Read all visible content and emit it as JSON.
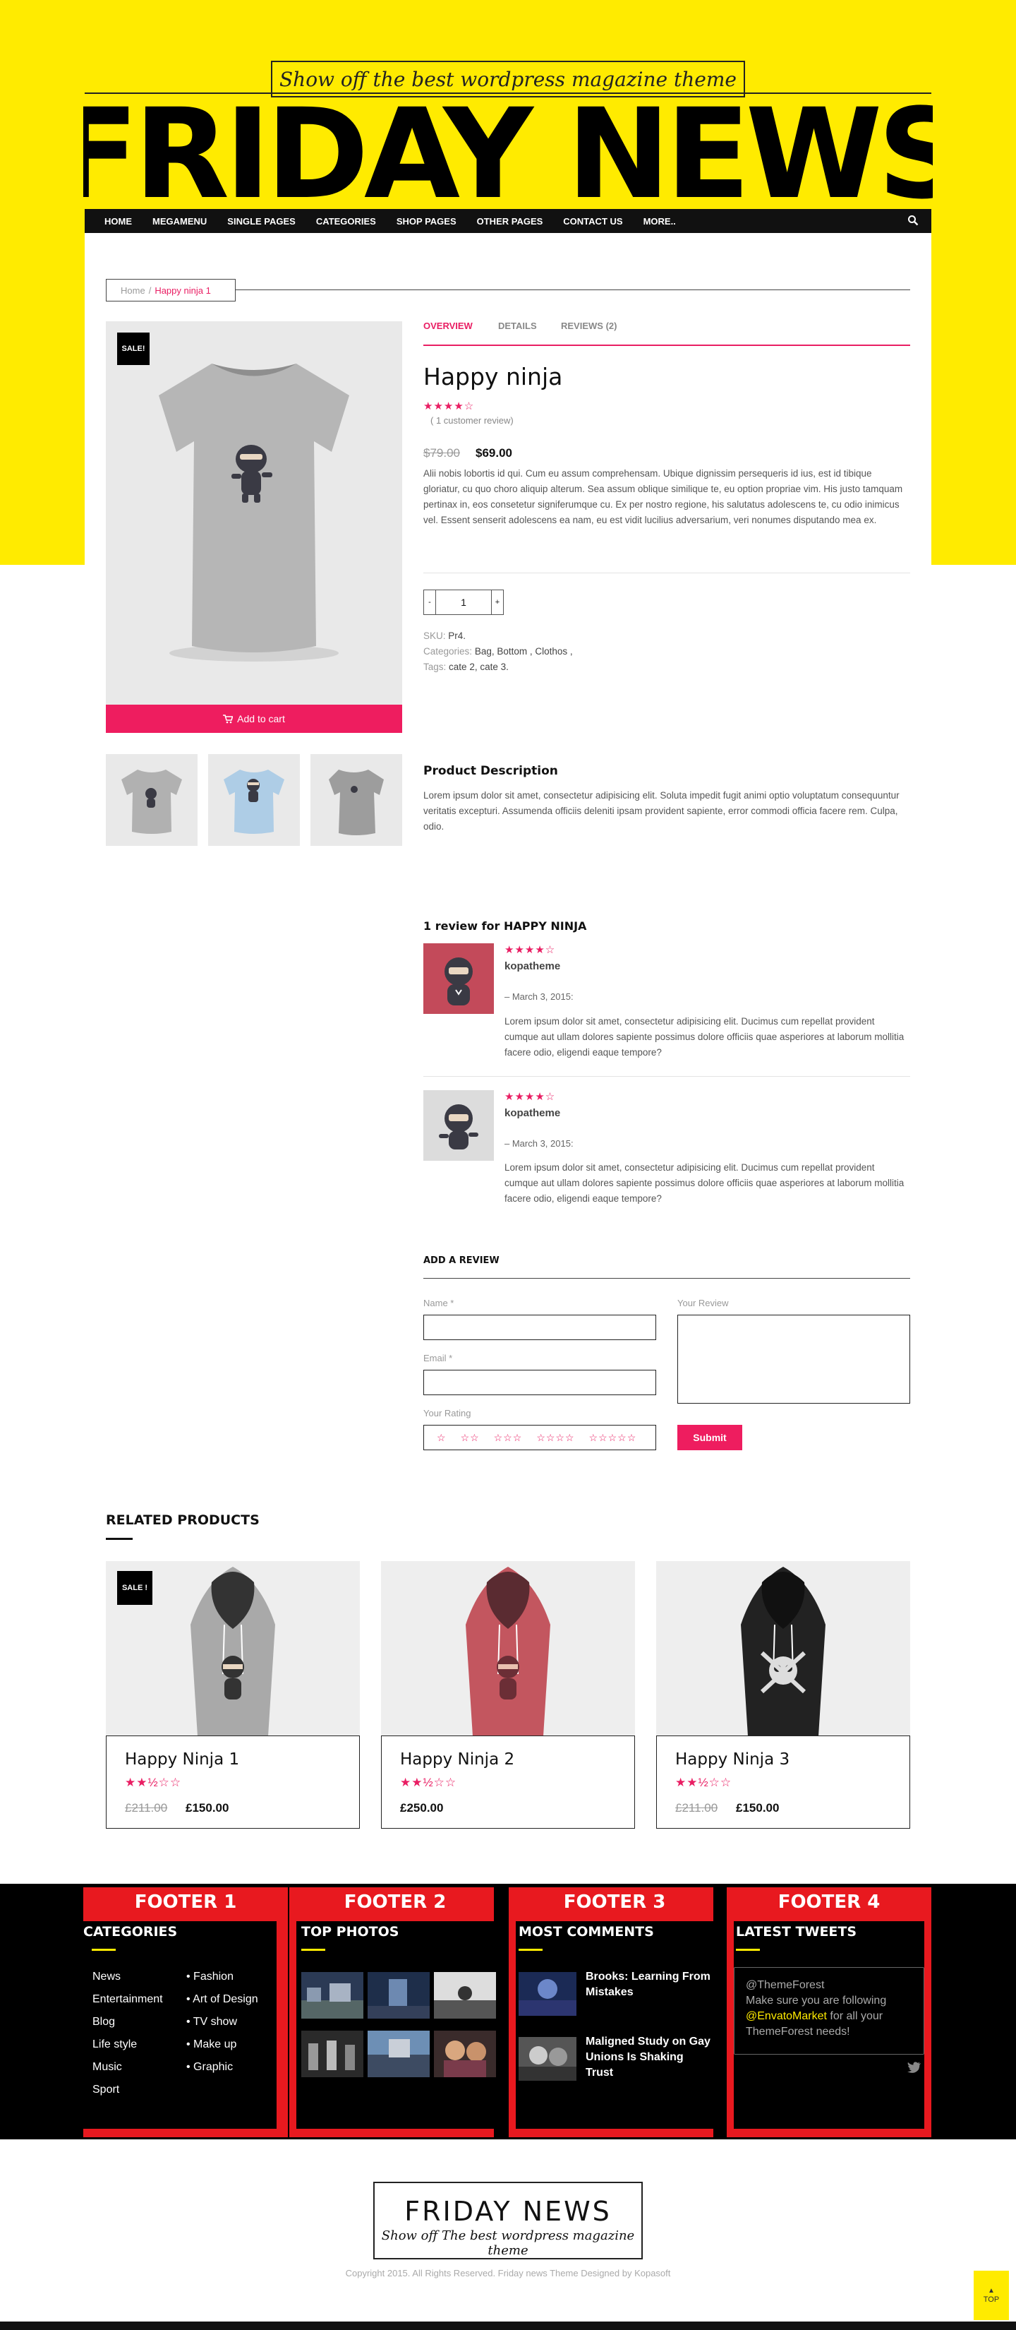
{
  "site": {
    "tagline": "Show off the best wordpress magazine theme",
    "logo": "FRIDAY NEWS",
    "nav": [
      "HOME",
      "MEGAMENU",
      "SINGLE PAGES",
      "CATEGORIES",
      "SHOP PAGES",
      "OTHER PAGES",
      "CONTACT US",
      "MORE.."
    ],
    "search_icon": "search-icon"
  },
  "breadcrumb": {
    "home": "Home",
    "separator": "/",
    "current": "Happy ninja 1"
  },
  "product": {
    "sale_badge": "SALE!",
    "add_to_cart": "Add to cart",
    "tabs": [
      "OVERVIEW",
      "DETAILS",
      "REVIEWS (2)"
    ],
    "title": "Happy ninja",
    "rating": 4,
    "rating_stars": "★★★★☆",
    "review_count": "( 1 customer review)",
    "old_price": "$79.00",
    "price": "$69.00",
    "description": "Alii nobis lobortis id qui. Cum eu assum comprehensam. Ubique dignissim persequeris id ius, est id tibique gloriatur, cu quo choro aliquip alterum. Sea assum oblique similique te, eu option propriae vim. His justo tamquam pertinax in, eos consetetur signiferumque cu. Ex per nostro regione, his salutatus adolescens te, cu odio inimicus vel. Essent senserit adolescens ea nam, eu est vidit lucilius adversarium, veri nonumes disputando mea ex.",
    "qty_minus": "-",
    "qty": "1",
    "qty_plus": "+",
    "sku_label": "SKU:",
    "sku": "Pr4.",
    "categories_label": "Categories:",
    "categories": "Bag, Bottom , Clothos ,",
    "tags_label": "Tags:",
    "tags": "cate 2, cate 3."
  },
  "product_description": {
    "title": "Product Description",
    "text": "Lorem ipsum dolor sit amet, consectetur adipisicing elit. Soluta impedit fugit animi optio voluptatum consequuntur veritatis excepturi. Assumenda officiis deleniti ipsam provident sapiente, error commodi officia facere rem. Culpa, odio."
  },
  "reviews": {
    "title": "1 review for HAPPY NINJA",
    "items": [
      {
        "stars": "★★★★☆",
        "name": "kopatheme",
        "date": "– March 3, 2015:",
        "text": "Lorem ipsum dolor sit amet, consectetur adipisicing elit. Ducimus cum repellat provident cumque aut ullam dolores sapiente possimus dolore officiis quae asperiores at laborum mollitia facere odio, eligendi eaque tempore?"
      },
      {
        "stars": "★★★★☆",
        "name": "kopatheme",
        "date": "– March 3, 2015:",
        "text": "Lorem ipsum dolor sit amet, consectetur adipisicing elit. Ducimus cum repellat provident cumque aut ullam dolores sapiente possimus dolore officiis quae asperiores at laborum mollitia facere odio, eligendi eaque tempore?"
      }
    ]
  },
  "add_review": {
    "title": "ADD A REVIEW",
    "name_label": "Name *",
    "email_label": "Email *",
    "review_label": "Your Review",
    "rating_label": "Your Rating",
    "rating_options": [
      "☆",
      "☆☆",
      "☆☆☆",
      "☆☆☆☆",
      "☆☆☆☆☆"
    ],
    "submit": "Submit"
  },
  "related": {
    "title": "RELATED PRODUCTS",
    "sale_badge": "SALE !",
    "items": [
      {
        "name": "Happy Ninja 1",
        "stars": "★★½☆☆",
        "old_price": "£211.00",
        "price": "£150.00",
        "color": "#a9a9a9"
      },
      {
        "name": "Happy Ninja 2",
        "stars": "★★½☆☆",
        "old_price": "",
        "price": "£250.00",
        "color": "#c3565f"
      },
      {
        "name": "Happy Ninja 3",
        "stars": "★★½☆☆",
        "old_price": "£211.00",
        "price": "£150.00",
        "color": "#222222"
      }
    ]
  },
  "footer": {
    "columns": [
      {
        "heading": "FOOTER 1",
        "subtitle": "CATEGORIES"
      },
      {
        "heading": "FOOTER 2",
        "subtitle": "TOP PHOTOS"
      },
      {
        "heading": "FOOTER 3",
        "subtitle": "MOST COMMENTS"
      },
      {
        "heading": "FOOTER 4",
        "subtitle": "LATEST TWEETS"
      }
    ],
    "categories_left": [
      "News",
      "Entertainment",
      "Blog",
      "Life style",
      "Music",
      "Sport"
    ],
    "categories_right": [
      "Fashion",
      "Art of Design",
      "TV show",
      "Make up",
      "Graphic"
    ],
    "comments": [
      "Brooks: Learning From Mistakes",
      "Maligned Study on Gay Unions Is Shaking Trust"
    ],
    "tweet": {
      "handle": "@ThemeForest",
      "pre": "Make sure you are following",
      "mention": "@EnvatoMarket",
      "post": "for all your ThemeForest needs!"
    },
    "logo": "FRIDAY NEWS",
    "tagline": "Show off The best wordpress magazine theme",
    "copyright": "Copyright 2015. All Rights Reserved. Friday news Theme Designed by Kopasoft",
    "top": "TOP"
  },
  "colors": {
    "brand_yellow": "#ffeb00",
    "accent_pink": "#e91e63",
    "footer_red": "#e8191f"
  }
}
